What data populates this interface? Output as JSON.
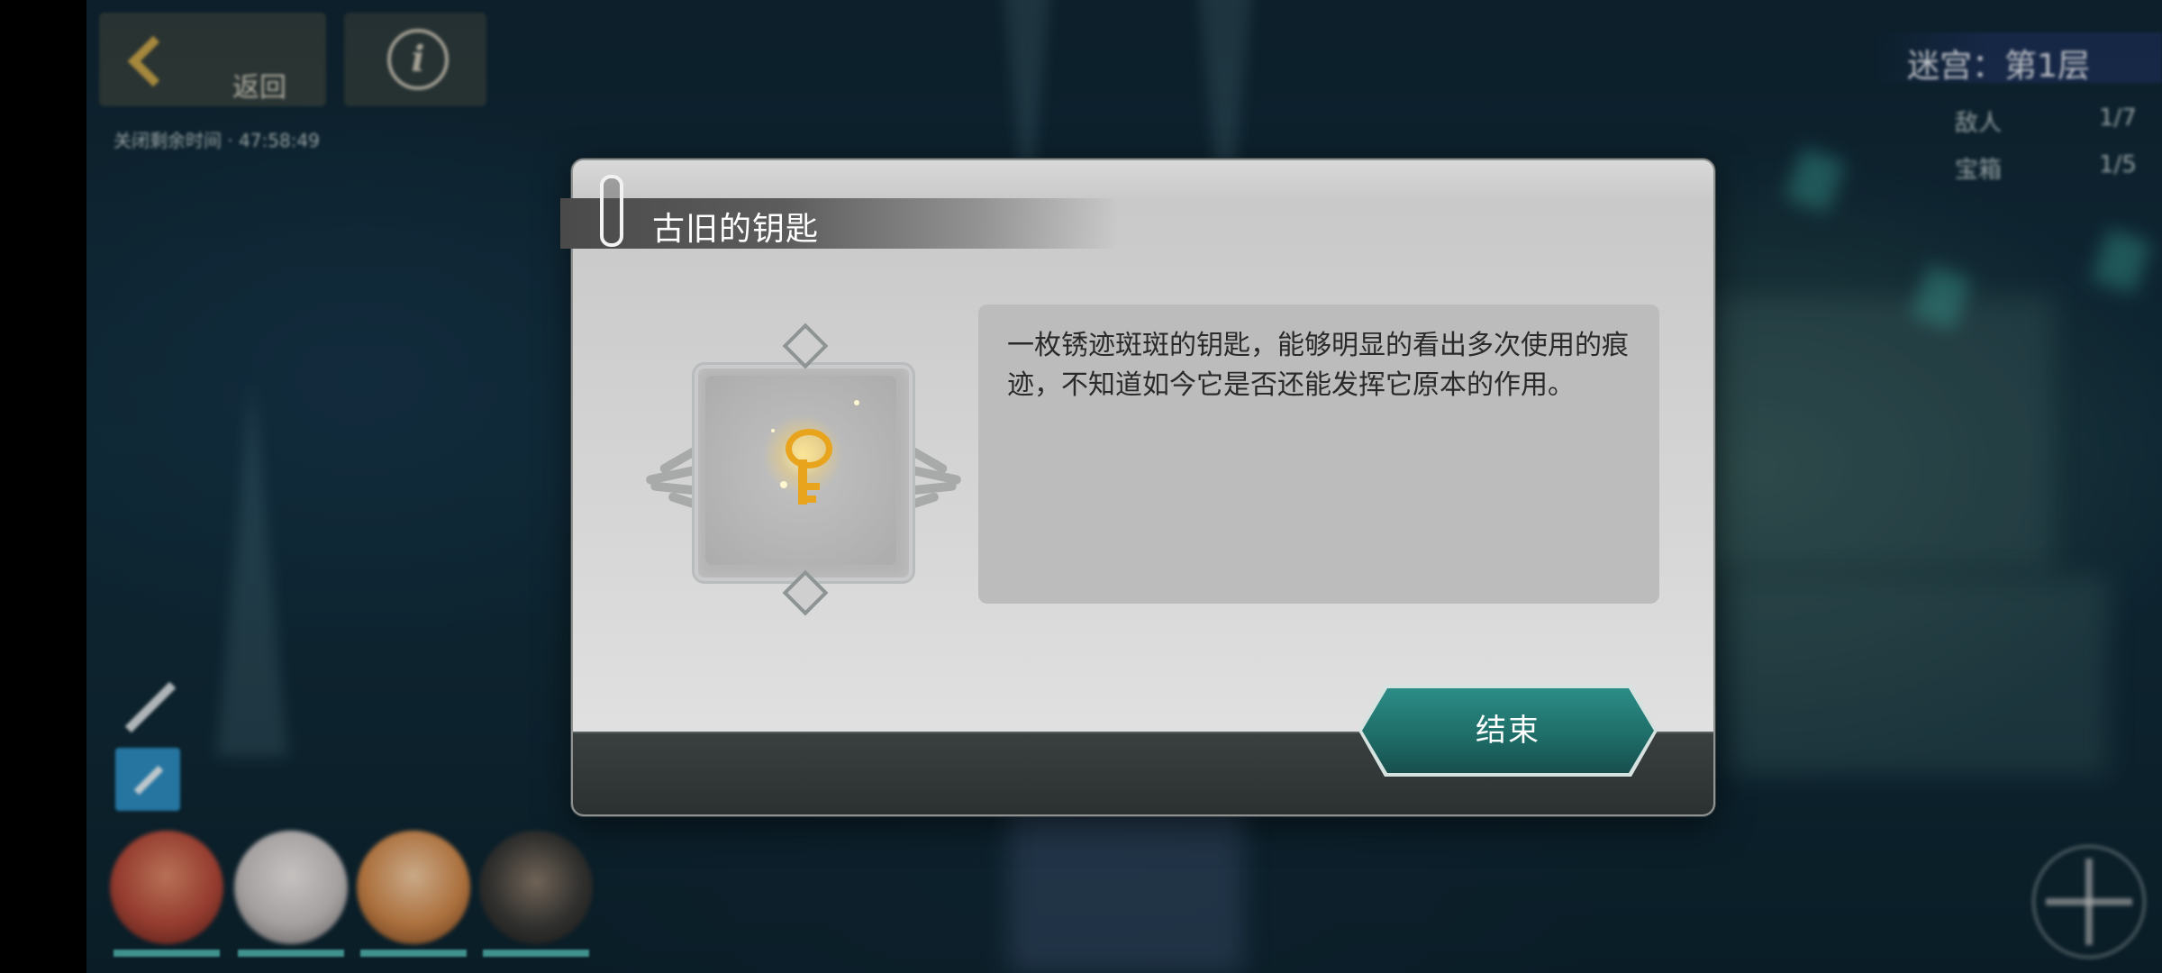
{
  "hud": {
    "back_label": "返回",
    "info_icon": "i",
    "timer_text": "关闭剩余时间 · 47:58:49",
    "stage_label": "迷宫：第1层",
    "stats": [
      {
        "label": "敌人",
        "value": "1/7"
      },
      {
        "label": "宝箱",
        "value": "1/5"
      }
    ],
    "icons": [
      "back-chevron-icon",
      "info-icon",
      "sword-icon",
      "arrow-skill-icon",
      "compass-icon"
    ]
  },
  "party": {
    "avatars": [
      {
        "name": "party-avatar-1",
        "color": "#b64a3a"
      },
      {
        "name": "party-avatar-2",
        "color": "#c9c4c4"
      },
      {
        "name": "party-avatar-3",
        "color": "#d28a4c"
      },
      {
        "name": "party-avatar-4",
        "color": "#3a3a38"
      }
    ]
  },
  "dialog": {
    "title": "古旧的钥匙",
    "description": "一枚锈迹斑斑的钥匙，能够明显的看出多次使用的痕迹，不知道如今它是否还能发挥它原本的作用。",
    "item_icon": "golden-key-icon",
    "end_button_label": "结束"
  },
  "colors": {
    "accent_teal": "#1f6e69",
    "key_gold": "#e9a41e",
    "dialog_bg": "#d6d6d6"
  }
}
